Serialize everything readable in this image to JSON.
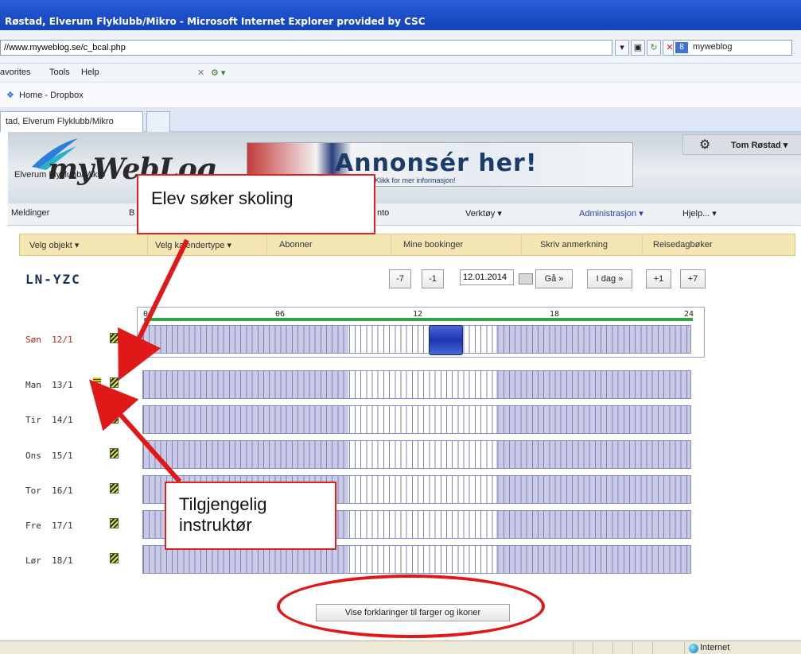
{
  "browser": {
    "title": "Røstad, Elverum Flyklubb/Mikro - Microsoft Internet Explorer provided by CSC",
    "address": "//www.myweblog.se/c_bcal.php",
    "search_value": "myweblog",
    "menu": [
      "avorites",
      "Tools",
      "Help"
    ],
    "favorites_item": "Home - Dropbox",
    "tab_label": "tad, Elverum Flyklubb/Mikro",
    "status_zone": "Internet"
  },
  "site": {
    "logo": "myWebLog",
    "club": "Elverum Flyklubb/Mikro",
    "banner_text": "Annonsér her!",
    "banner_sub": "Klikk for mer informasjon!",
    "user_name": "Tom Røstad"
  },
  "mainnav": {
    "meldinger": "Meldinger",
    "b": "B",
    "konto": "nto",
    "verktoy": "Verktøy ▾",
    "administrasjon": "Administrasjon ▾",
    "hjelp": "Hjelp... ▾"
  },
  "subnav": {
    "velg_objekt": "Velg objekt ▾",
    "velg_kalendertype": "Velg kalendertype ▾",
    "abonner": "Abonner",
    "mine_bookinger": "Mine bookinger",
    "skriv_anmerkning": "Skriv anmerkning",
    "reisedagboker": "Reisedagbøker"
  },
  "calendar": {
    "registration": "LN-YZC",
    "btn_minus7": "-7",
    "btn_minus1": "-1",
    "date": "12.01.2014",
    "btn_go": "Gå »",
    "btn_today": "I dag »",
    "btn_plus1": "+1",
    "btn_plus7": "+7",
    "hours": [
      "0",
      "06",
      "12",
      "18",
      "24"
    ],
    "days": [
      {
        "name": "Søn",
        "date": "12/1",
        "today": true
      },
      {
        "name": "Man",
        "date": "13/1",
        "student": true
      },
      {
        "name": "Tir",
        "date": "14/1"
      },
      {
        "name": "Ons",
        "date": "15/1"
      },
      {
        "name": "Tor",
        "date": "16/1"
      },
      {
        "name": "Fre",
        "date": "17/1"
      },
      {
        "name": "Lør",
        "date": "18/1"
      }
    ],
    "legend_button": "Vise forklaringer til farger og ikoner"
  },
  "annotations": {
    "student": "Elev søker skoling",
    "instructor_line1": "Tilgjengelig",
    "instructor_line2": "instruktør",
    "color": "#e01818"
  }
}
